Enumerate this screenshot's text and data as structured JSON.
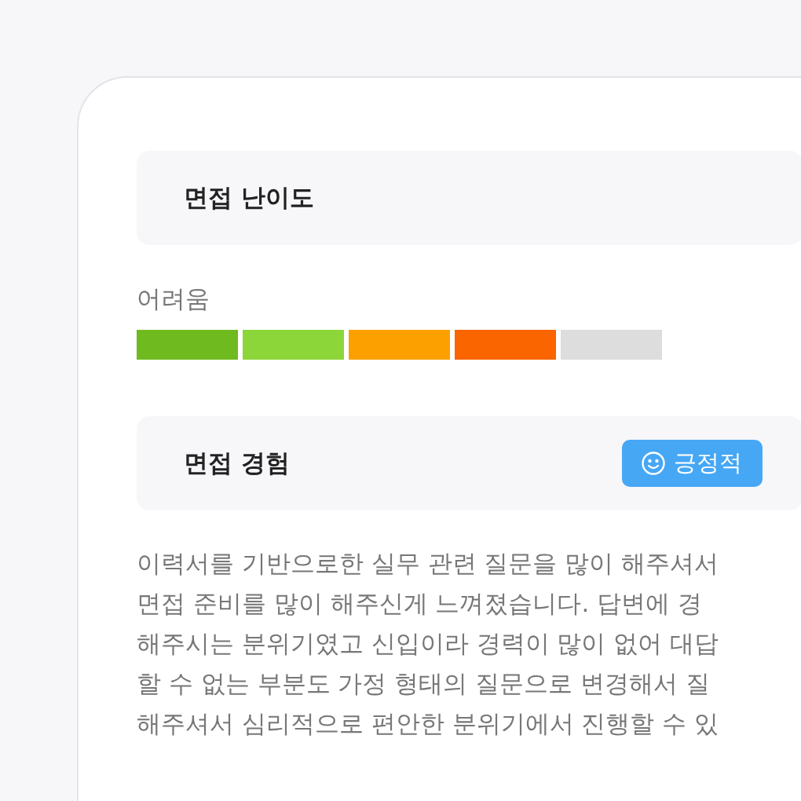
{
  "difficulty_section": {
    "title": "면접 난이도",
    "label": "어려움",
    "level": 0.8
  },
  "experience_section": {
    "title": "면접 경험",
    "badge": {
      "kind": "positive",
      "label": "긍정적"
    },
    "review_lines": [
      "이력서를 기반으로한 실무 관련 질문을 많이 해주셔서",
      "면접 준비를 많이 해주신게 느껴졌습니다. 답변에 경",
      "해주시는 분위기였고 신입이라 경력이 많이 없어 대답",
      "할 수 없는 부분도 가정 형태의 질문으로 변경해서 질",
      "해주셔서 심리적으로 편안한 분위기에서 진행할 수 있"
    ]
  }
}
